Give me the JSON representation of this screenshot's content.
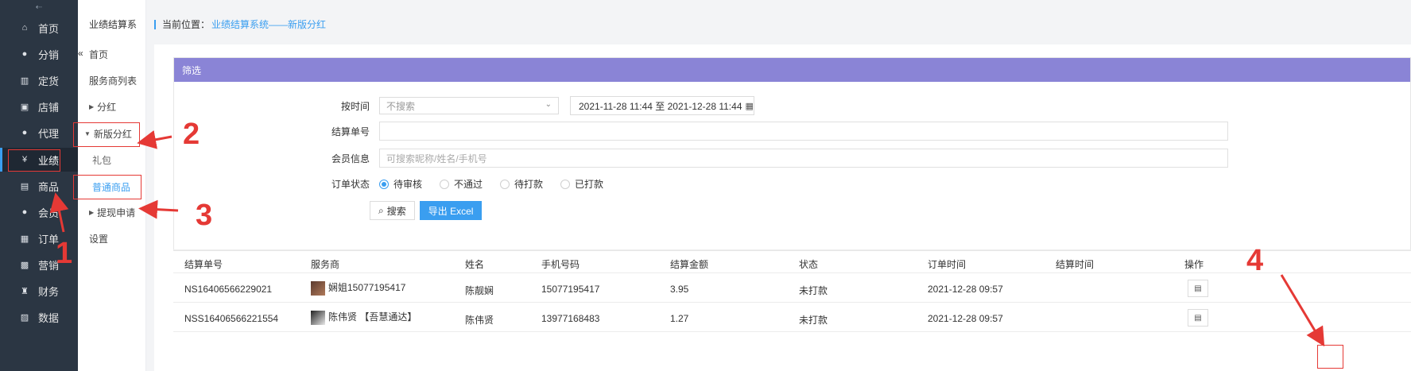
{
  "sidebar": {
    "collapse_icon": "⇠",
    "items": [
      {
        "label": "首页",
        "icon": "⌂"
      },
      {
        "label": "分销",
        "icon": "●"
      },
      {
        "label": "定货",
        "icon": "▥"
      },
      {
        "label": "店铺",
        "icon": "▣"
      },
      {
        "label": "代理",
        "icon": "●"
      },
      {
        "label": "业绩",
        "icon": "¥"
      },
      {
        "label": "商品",
        "icon": "▤"
      },
      {
        "label": "会员",
        "icon": "●"
      },
      {
        "label": "订单",
        "icon": "▦"
      },
      {
        "label": "营销",
        "icon": "▩"
      },
      {
        "label": "财务",
        "icon": "♜"
      },
      {
        "label": "数据",
        "icon": "▨"
      }
    ],
    "active_index": 5
  },
  "subnav": {
    "title": "业绩结算系",
    "close": "«",
    "items": [
      {
        "label": "首页"
      },
      {
        "label": "服务商列表"
      },
      {
        "label": "分红",
        "caret": "▶"
      },
      {
        "label": "新版分红",
        "caret": "▼"
      },
      {
        "label": "礼包"
      },
      {
        "label": "普通商品"
      },
      {
        "label": "提现申请",
        "caret": "▶"
      },
      {
        "label": "设置"
      }
    ]
  },
  "breadcrumb": {
    "prefix": "当前位置：",
    "path": "业绩结算系统——新版分红"
  },
  "filter": {
    "title": "筛选",
    "time_label": "按时间",
    "time_select": "不搜索",
    "date_range": "2021-11-28 11:44 至 2021-12-28 11:44",
    "settle_label": "结算单号",
    "settle_value": "",
    "member_label": "会员信息",
    "member_placeholder": "可搜索昵称/姓名/手机号",
    "status_label": "订单状态",
    "status_options": [
      "待审核",
      "不通过",
      "待打款",
      "已打款"
    ],
    "status_selected": 0,
    "search_button": "搜索",
    "export_button": "导出 Excel"
  },
  "table": {
    "headers": [
      "结算单号",
      "服务商",
      "姓名",
      "手机号码",
      "结算金额",
      "状态",
      "订单时间",
      "结算时间",
      "操作"
    ],
    "rows": [
      {
        "no": "NS16406566229021",
        "provider": "娴姐15077195417",
        "name": "陈靓娴",
        "phone": "15077195417",
        "amount": "3.95",
        "status": "未打款",
        "order_time": "2021-12-28 09:57",
        "settle_time": ""
      },
      {
        "no": "NSS16406566221554",
        "provider": "陈伟贤 【吾慧通达】",
        "name": "陈伟贤",
        "phone": "13977168483",
        "amount": "1.27",
        "status": "未打款",
        "order_time": "2021-12-28 09:57",
        "settle_time": ""
      }
    ]
  },
  "annotations": {
    "labels": [
      "1",
      "2",
      "3",
      "4"
    ],
    "color": "#e53935"
  },
  "colors": {
    "accent": "#3a9ef0",
    "sidebar_bg": "#2b3643",
    "filter_header": "#8a84d6"
  }
}
